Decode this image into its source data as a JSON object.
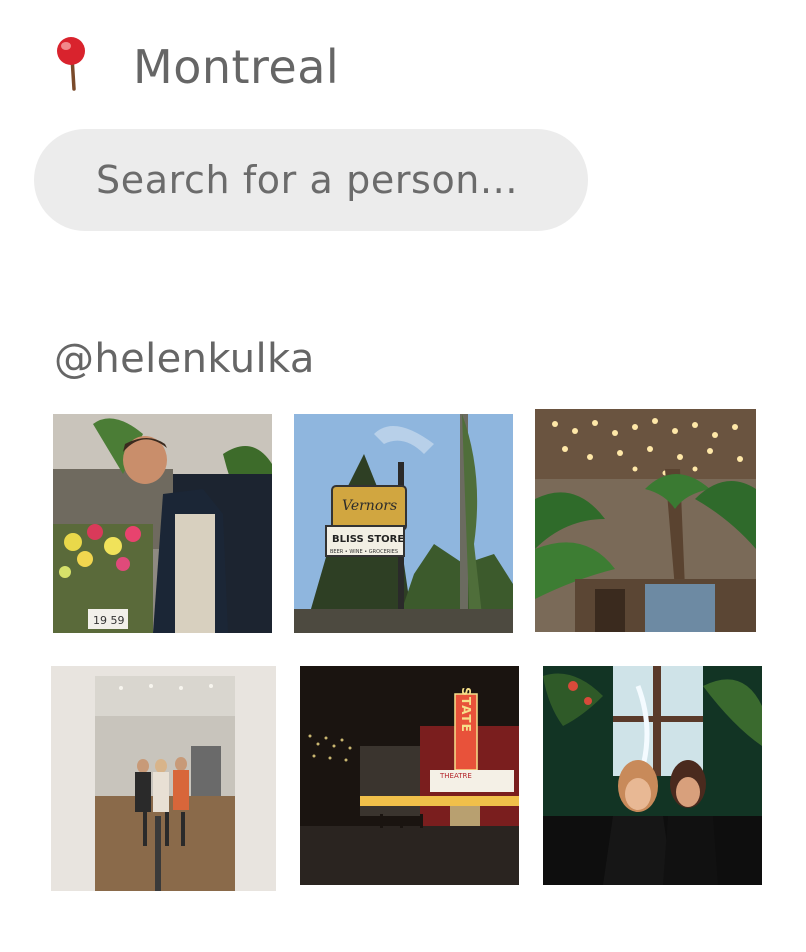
{
  "location": {
    "icon": "pushpin-icon",
    "name": "Montreal"
  },
  "search": {
    "placeholder": "Search for a person...",
    "icon": "none"
  },
  "profile": {
    "username": "@helenkulka"
  },
  "photos": [
    {
      "name": "photo-flowers-man",
      "sign_text": "19 59"
    },
    {
      "name": "photo-vernors-sign",
      "sign_text": "Vernors",
      "sign_text2": "BLISS STORE",
      "sign_text3": "BEER • WINE • GROCERIES"
    },
    {
      "name": "photo-restaurant-lights"
    },
    {
      "name": "photo-gallery-mirror"
    },
    {
      "name": "photo-state-theatre",
      "sign_text": "STATE",
      "sign_text2": "THEATRE"
    },
    {
      "name": "photo-two-women-bar"
    }
  ],
  "colors": {
    "text": "#666666",
    "search_bg": "#ececec",
    "pin_head": "#d9232d"
  }
}
